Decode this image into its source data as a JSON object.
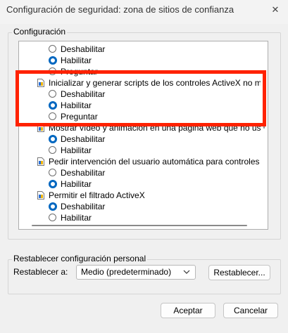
{
  "window": {
    "title": "Configuración de seguridad: zona de sitios de confianza",
    "close_glyph": "✕"
  },
  "settings_group": {
    "label": "Configuración",
    "rows": [
      {
        "kind": "radio",
        "label": "Deshabilitar",
        "selected": false
      },
      {
        "kind": "radio",
        "label": "Habilitar",
        "selected": true
      },
      {
        "kind": "radio",
        "label": "Preguntar",
        "selected": false
      },
      {
        "kind": "heading",
        "label": "Inicializar y generar scripts de los controles ActiveX no marca",
        "icon": "settings-doc-icon"
      },
      {
        "kind": "radio",
        "label": "Deshabilitar",
        "selected": false
      },
      {
        "kind": "radio",
        "label": "Habilitar",
        "selected": true
      },
      {
        "kind": "radio",
        "label": "Preguntar",
        "selected": false
      },
      {
        "kind": "heading",
        "label": "Mostrar vídeo y animación en una página web que no use un reproductor",
        "icon": "settings-doc-icon"
      },
      {
        "kind": "radio",
        "label": "Deshabilitar",
        "selected": true
      },
      {
        "kind": "radio",
        "label": "Habilitar",
        "selected": false
      },
      {
        "kind": "heading",
        "label": "Pedir intervención del usuario automática para controles Acti",
        "icon": "settings-doc-icon"
      },
      {
        "kind": "radio",
        "label": "Deshabilitar",
        "selected": false
      },
      {
        "kind": "radio",
        "label": "Habilitar",
        "selected": true
      },
      {
        "kind": "heading",
        "label": "Permitir el filtrado ActiveX",
        "icon": "settings-doc-icon"
      },
      {
        "kind": "radio",
        "label": "Deshabilitar",
        "selected": true
      },
      {
        "kind": "radio",
        "label": "Habilitar",
        "selected": false
      }
    ]
  },
  "reset_group": {
    "label": "Restablecer configuración personal",
    "reset_to_label": "Restablecer a:",
    "selected_level": "Medio (predeterminado)",
    "reset_button": "Restablecer..."
  },
  "footer": {
    "ok_label": "Aceptar",
    "cancel_label": "Cancelar"
  },
  "colors": {
    "highlight": "#ff2200",
    "radio_selected": "#0067c0"
  }
}
